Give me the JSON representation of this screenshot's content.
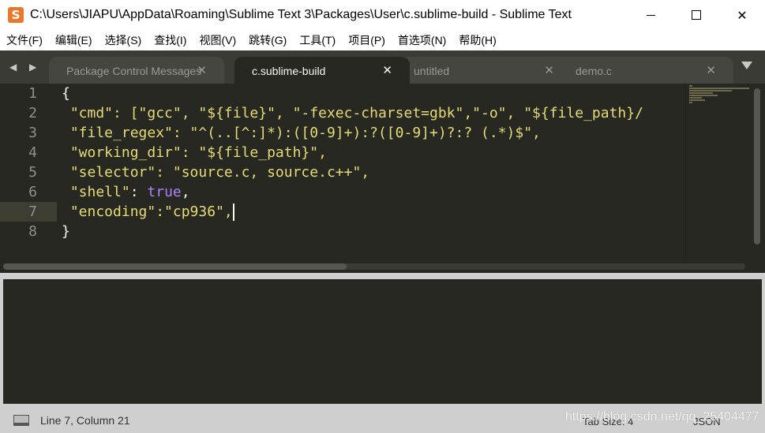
{
  "window": {
    "title": "C:\\Users\\JIAPU\\AppData\\Roaming\\Sublime Text 3\\Packages\\User\\c.sublime-build - Sublime Text",
    "app_icon_glyph": "S",
    "minimize_icon": "minimize-icon",
    "maximize_icon": "maximize-icon",
    "close_glyph": "✕"
  },
  "menu": [
    "文件(F)",
    "编辑(E)",
    "选择(S)",
    "查找(I)",
    "视图(V)",
    "跳转(G)",
    "工具(T)",
    "项目(P)",
    "首选项(N)",
    "帮助(H)"
  ],
  "tabs": {
    "nav_glyph": "◀ ▶",
    "items": [
      {
        "label": "Package Control Messages",
        "close": "✕",
        "active": false
      },
      {
        "label": "c.sublime-build",
        "close": "✕",
        "active": true
      },
      {
        "label": "untitled",
        "close": "✕",
        "active": false
      },
      {
        "label": "demo.c",
        "close": "✕",
        "active": false
      }
    ]
  },
  "editor": {
    "line_numbers": [
      "1",
      "2",
      "3",
      "4",
      "5",
      "6",
      "7",
      "8"
    ],
    "current_line": 7,
    "lines": {
      "l1": "{",
      "l2": " \"cmd\": [\"gcc\", \"${file}\", \"-fexec-charset=gbk\",\"-o\", \"${file_path}/",
      "l3": " \"file_regex\": \"^(..[^:]*):([0-9]+):?([0-9]+)?:? (.*)$\",",
      "l4": " \"working_dir\": \"${file_path}\",",
      "l5": " \"selector\": \"source.c, source.c++\",",
      "l6_key": " \"shell\"",
      "l6_sep": ": ",
      "l6_val": "true",
      "l6_end": ",",
      "l7": " \"encoding\":\"cp936\",",
      "l8": "}"
    }
  },
  "status": {
    "position": "Line 7, Column 21",
    "tab_size": "Tab Size: 4",
    "syntax": "JSON",
    "watermark": "https://blog.csdn.net/qq_25404477"
  },
  "colors": {
    "background": "#272822",
    "string": "#e6db74",
    "constant": "#ae81ff",
    "foreground": "#f8f8f2",
    "gutter": "#90908a"
  }
}
